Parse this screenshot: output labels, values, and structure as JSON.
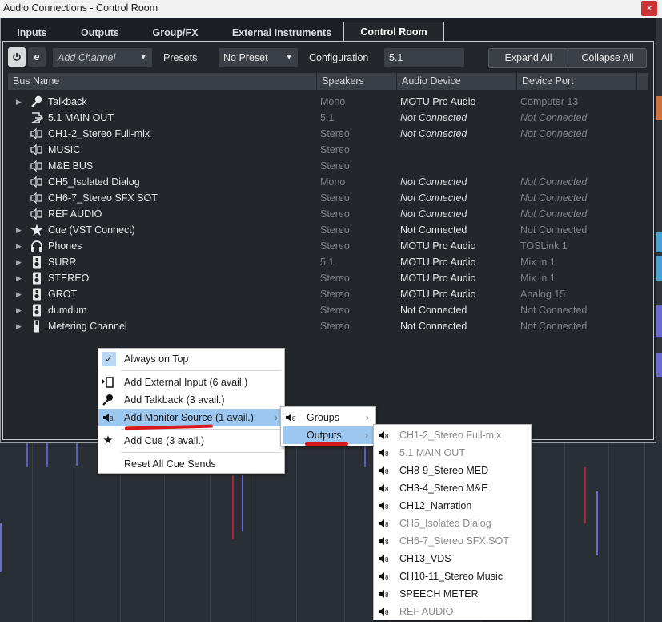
{
  "window": {
    "title": "Audio Connections - Control Room",
    "close_glyph": "×"
  },
  "tabs": [
    {
      "label": "Inputs"
    },
    {
      "label": "Outputs"
    },
    {
      "label": "Group/FX"
    },
    {
      "label": "External Instruments"
    },
    {
      "label": "Control Room",
      "active": true
    }
  ],
  "toolbar": {
    "power_icon": "power-icon",
    "e_label": "e",
    "add_channel": {
      "value": "Add Channel"
    },
    "presets_label": "Presets",
    "preset_value": "No Preset",
    "configuration_label": "Configuration",
    "configuration_value": "5.1",
    "expand_all": "Expand All",
    "collapse_all": "Collapse All"
  },
  "columns": [
    "Bus Name",
    "Speakers",
    "Audio Device",
    "Device Port"
  ],
  "rows": [
    {
      "name": "Talkback",
      "icon": "microphone-icon",
      "speakers": "Mono",
      "device": "MOTU Pro Audio",
      "port": "Computer 13",
      "expandable": true
    },
    {
      "name": "5.1 MAIN OUT",
      "icon": "output-icon",
      "speakers": "5.1",
      "device": "Not Connected",
      "port": "Not Connected",
      "italic": true
    },
    {
      "name": "CH1-2_Stereo Full-mix",
      "icon": "speaker-icon",
      "speakers": "Stereo",
      "device": "Not Connected",
      "port": "Not Connected",
      "italic": true
    },
    {
      "name": "MUSIC",
      "icon": "speaker-icon",
      "speakers": "Stereo",
      "device": "",
      "port": ""
    },
    {
      "name": "M&E BUS",
      "icon": "speaker-icon",
      "speakers": "Stereo",
      "device": "",
      "port": ""
    },
    {
      "name": "CH5_Isolated Dialog",
      "icon": "speaker-icon",
      "speakers": "Mono",
      "device": "Not Connected",
      "port": "Not Connected",
      "italic": true
    },
    {
      "name": "CH6-7_Stereo SFX SOT",
      "icon": "speaker-icon",
      "speakers": "Stereo",
      "device": "Not Connected",
      "port": "Not Connected",
      "italic": true
    },
    {
      "name": "REF AUDIO",
      "icon": "speaker-icon",
      "speakers": "Stereo",
      "device": "Not Connected",
      "port": "Not Connected",
      "italic": true
    },
    {
      "name": "Cue (VST Connect)",
      "icon": "star-icon",
      "speakers": "Stereo",
      "device": "Not Connected",
      "port": "Not Connected",
      "expandable": true
    },
    {
      "name": "Phones",
      "icon": "headphones-icon",
      "speakers": "Stereo",
      "device": "MOTU Pro Audio",
      "port": "TOSLink 1",
      "expandable": true
    },
    {
      "name": "SURR",
      "icon": "monitor-speaker-icon",
      "speakers": "5.1",
      "device": "MOTU Pro Audio",
      "port": "Mix In 1",
      "expandable": true
    },
    {
      "name": "STEREO",
      "icon": "monitor-speaker-icon",
      "speakers": "Stereo",
      "device": "MOTU Pro Audio",
      "port": "Mix In 1",
      "expandable": true
    },
    {
      "name": "GROT",
      "icon": "monitor-speaker-icon",
      "speakers": "Stereo",
      "device": "MOTU Pro Audio",
      "port": "Analog 15",
      "expandable": true
    },
    {
      "name": "dumdum",
      "icon": "monitor-speaker-icon",
      "speakers": "Stereo",
      "device": "Not Connected",
      "port": "Not Connected",
      "expandable": true
    },
    {
      "name": "Metering Channel",
      "icon": "meter-icon",
      "speakers": "Stereo",
      "device": "Not Connected",
      "port": "Not Connected",
      "expandable": true
    }
  ],
  "context_menu": {
    "items": [
      {
        "label": "Always on Top",
        "icon": "check-icon"
      },
      {
        "label": "Add External Input (6 avail.)",
        "icon": "external-input-icon"
      },
      {
        "label": "Add Talkback (3 avail.)",
        "icon": "microphone-icon"
      },
      {
        "label": "Add Monitor Source (1 avail.)",
        "icon": "speaker-icon",
        "submenu": true,
        "highlighted": true
      },
      {
        "label": "Add Cue (3 avail.)",
        "icon": "star-icon"
      },
      {
        "label": "Reset All Cue Sends",
        "icon": ""
      }
    ]
  },
  "submenu_monitor": {
    "items": [
      {
        "label": "Groups",
        "submenu": true
      },
      {
        "label": "Outputs",
        "submenu": true,
        "highlighted": true
      }
    ]
  },
  "submenu_outputs": {
    "items": [
      {
        "label": "CH1-2_Stereo Full-mix",
        "disabled": true
      },
      {
        "label": "5.1 MAIN OUT",
        "disabled": true
      },
      {
        "label": "CH8-9_Stereo MED",
        "disabled": false
      },
      {
        "label": "CH3-4_Stereo M&E",
        "disabled": false
      },
      {
        "label": "CH12_Narration",
        "disabled": false
      },
      {
        "label": "CH5_Isolated Dialog",
        "disabled": true
      },
      {
        "label": "CH6-7_Stereo SFX SOT",
        "disabled": true
      },
      {
        "label": "CH13_VDS",
        "disabled": false
      },
      {
        "label": "CH10-11_Stereo Music",
        "disabled": false
      },
      {
        "label": "SPEECH METER",
        "disabled": false
      },
      {
        "label": "REF AUDIO",
        "disabled": true
      }
    ]
  },
  "glyphs": {
    "speaker": "🔈︎",
    "check": "✓",
    "star": "★",
    "chevron": "›",
    "expand": "▶",
    "dropdown": "▼"
  },
  "colors": {
    "accent_highlight": "#9cc7f0",
    "annotation_red": "#d8191c",
    "background": "#23272c"
  }
}
